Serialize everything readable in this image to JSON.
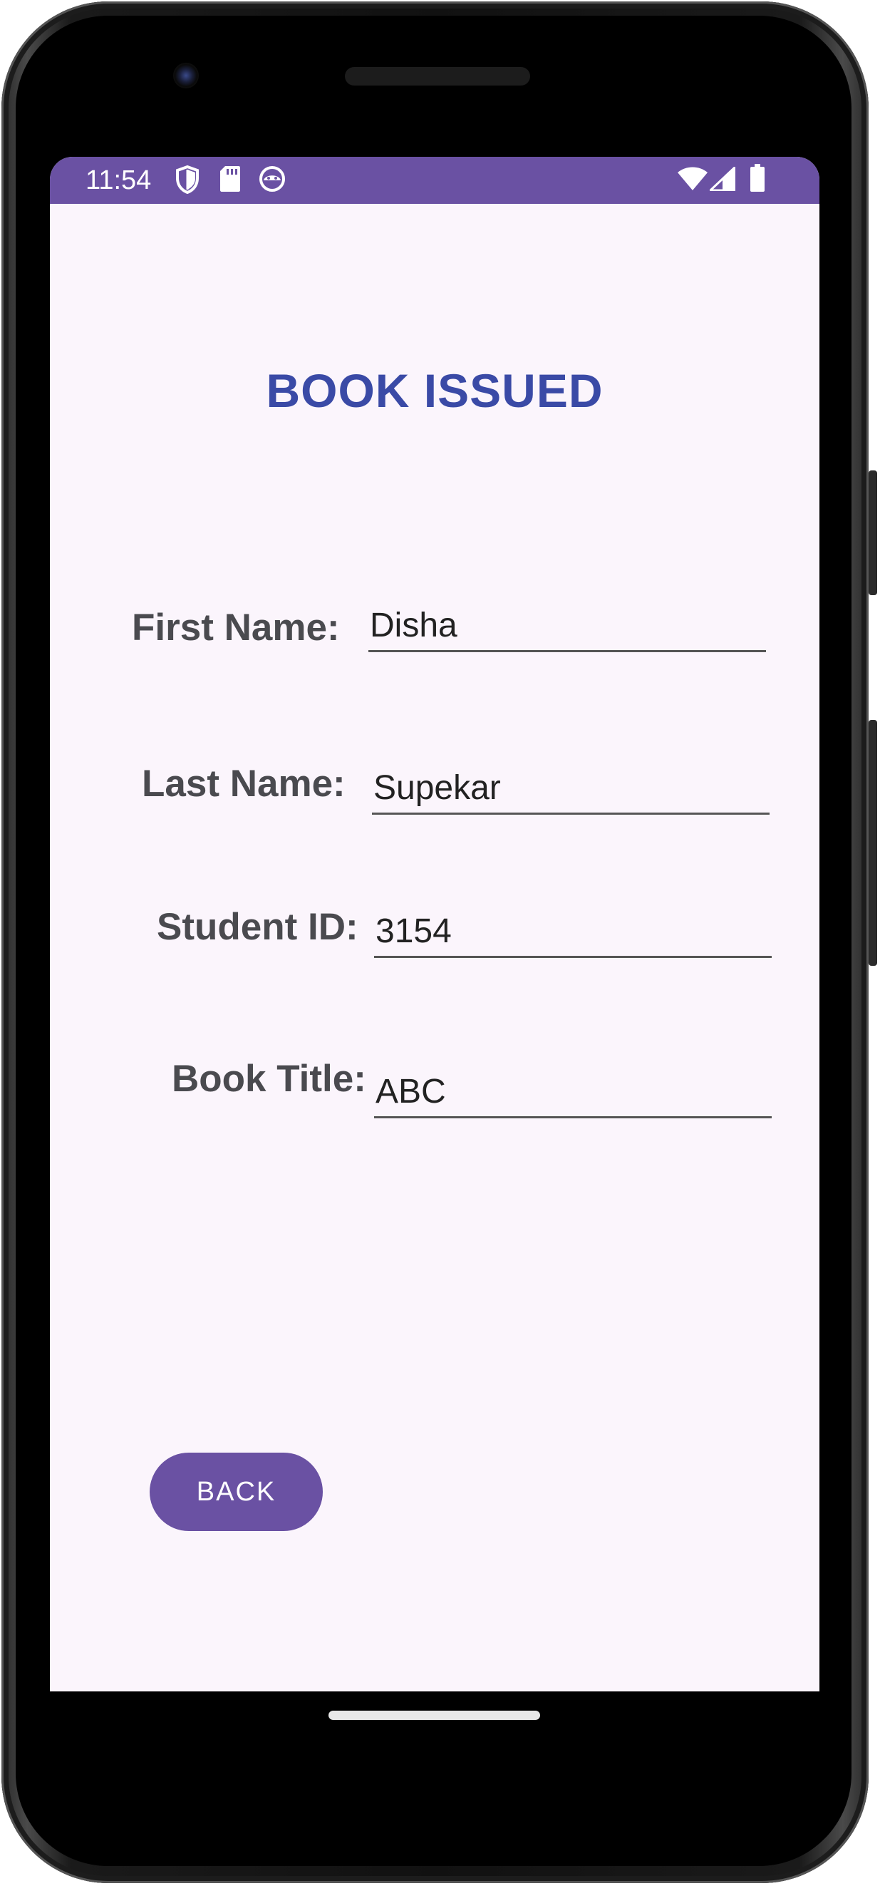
{
  "status_bar": {
    "time": "11:54",
    "left_icons": [
      "shield-icon",
      "sd-card-icon",
      "android-face-icon"
    ],
    "right_icons": [
      "wifi-icon",
      "signal-icon",
      "battery-icon"
    ],
    "color": "#6a51a3"
  },
  "title": "BOOK ISSUED",
  "form": {
    "first_name": {
      "label": "First Name:",
      "value": "Disha"
    },
    "last_name": {
      "label": "Last Name:",
      "value": "Supekar"
    },
    "student_id": {
      "label": "Student ID:",
      "value": "3154"
    },
    "book_title": {
      "label": "Book Title:",
      "value": "ABC"
    }
  },
  "back_button": {
    "label": "BACK"
  },
  "colors": {
    "accent": "#6a51a3",
    "title": "#3a4aa6",
    "background": "#fbf5fc",
    "label": "#4a4a4f"
  }
}
